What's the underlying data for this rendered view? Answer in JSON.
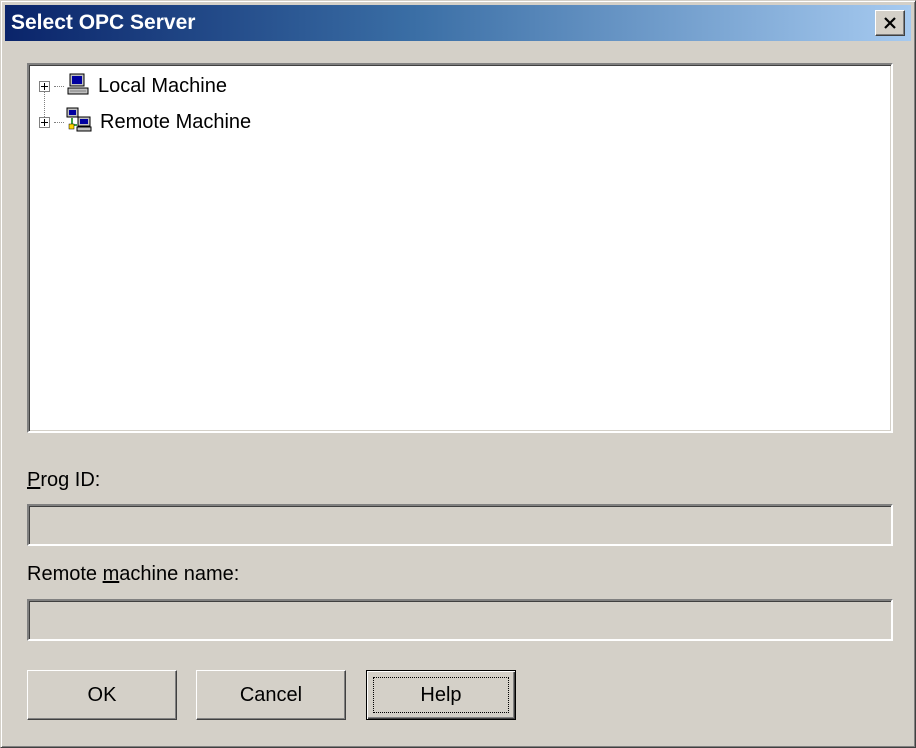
{
  "window": {
    "title": "Select OPC Server",
    "close_icon": "close-icon"
  },
  "tree": {
    "items": [
      {
        "label": "Local Machine",
        "icon": "computer-icon",
        "expanded": false
      },
      {
        "label": "Remote Machine",
        "icon": "network-computers-icon",
        "expanded": false
      }
    ]
  },
  "prog_id": {
    "label_prefix": "",
    "label_mnemonic": "P",
    "label_rest": "rog ID:",
    "value": ""
  },
  "remote_machine": {
    "label_prefix": "Remote ",
    "label_mnemonic": "m",
    "label_rest": "achine name:",
    "value": ""
  },
  "buttons": {
    "ok_label": "OK",
    "cancel_label": "Cancel",
    "help_label": "Help"
  },
  "colors": {
    "title_start": "#0a246a",
    "title_end": "#a6caf0",
    "face": "#d4d0c8"
  }
}
